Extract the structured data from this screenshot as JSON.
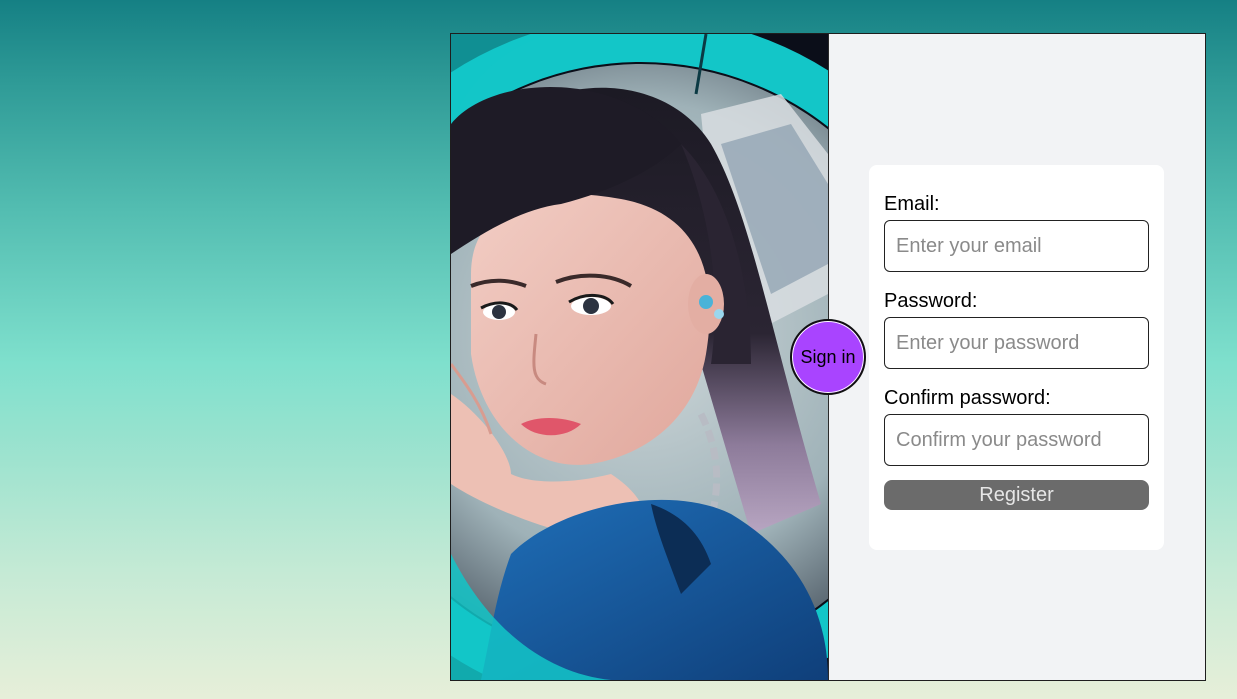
{
  "photo": {
    "alt": "portrait photo"
  },
  "toggle": {
    "sign_in_label": "Sign in",
    "color": "#a944ff"
  },
  "register_form": {
    "email_label": "Email:",
    "email_placeholder": "Enter your email",
    "email_value": "",
    "password_label": "Password:",
    "password_placeholder": "Enter your password",
    "password_value": "",
    "confirm_label": "Confirm password:",
    "confirm_placeholder": "Confirm your password",
    "confirm_value": "",
    "register_label": "Register",
    "register_color": "#6b6b6b"
  }
}
